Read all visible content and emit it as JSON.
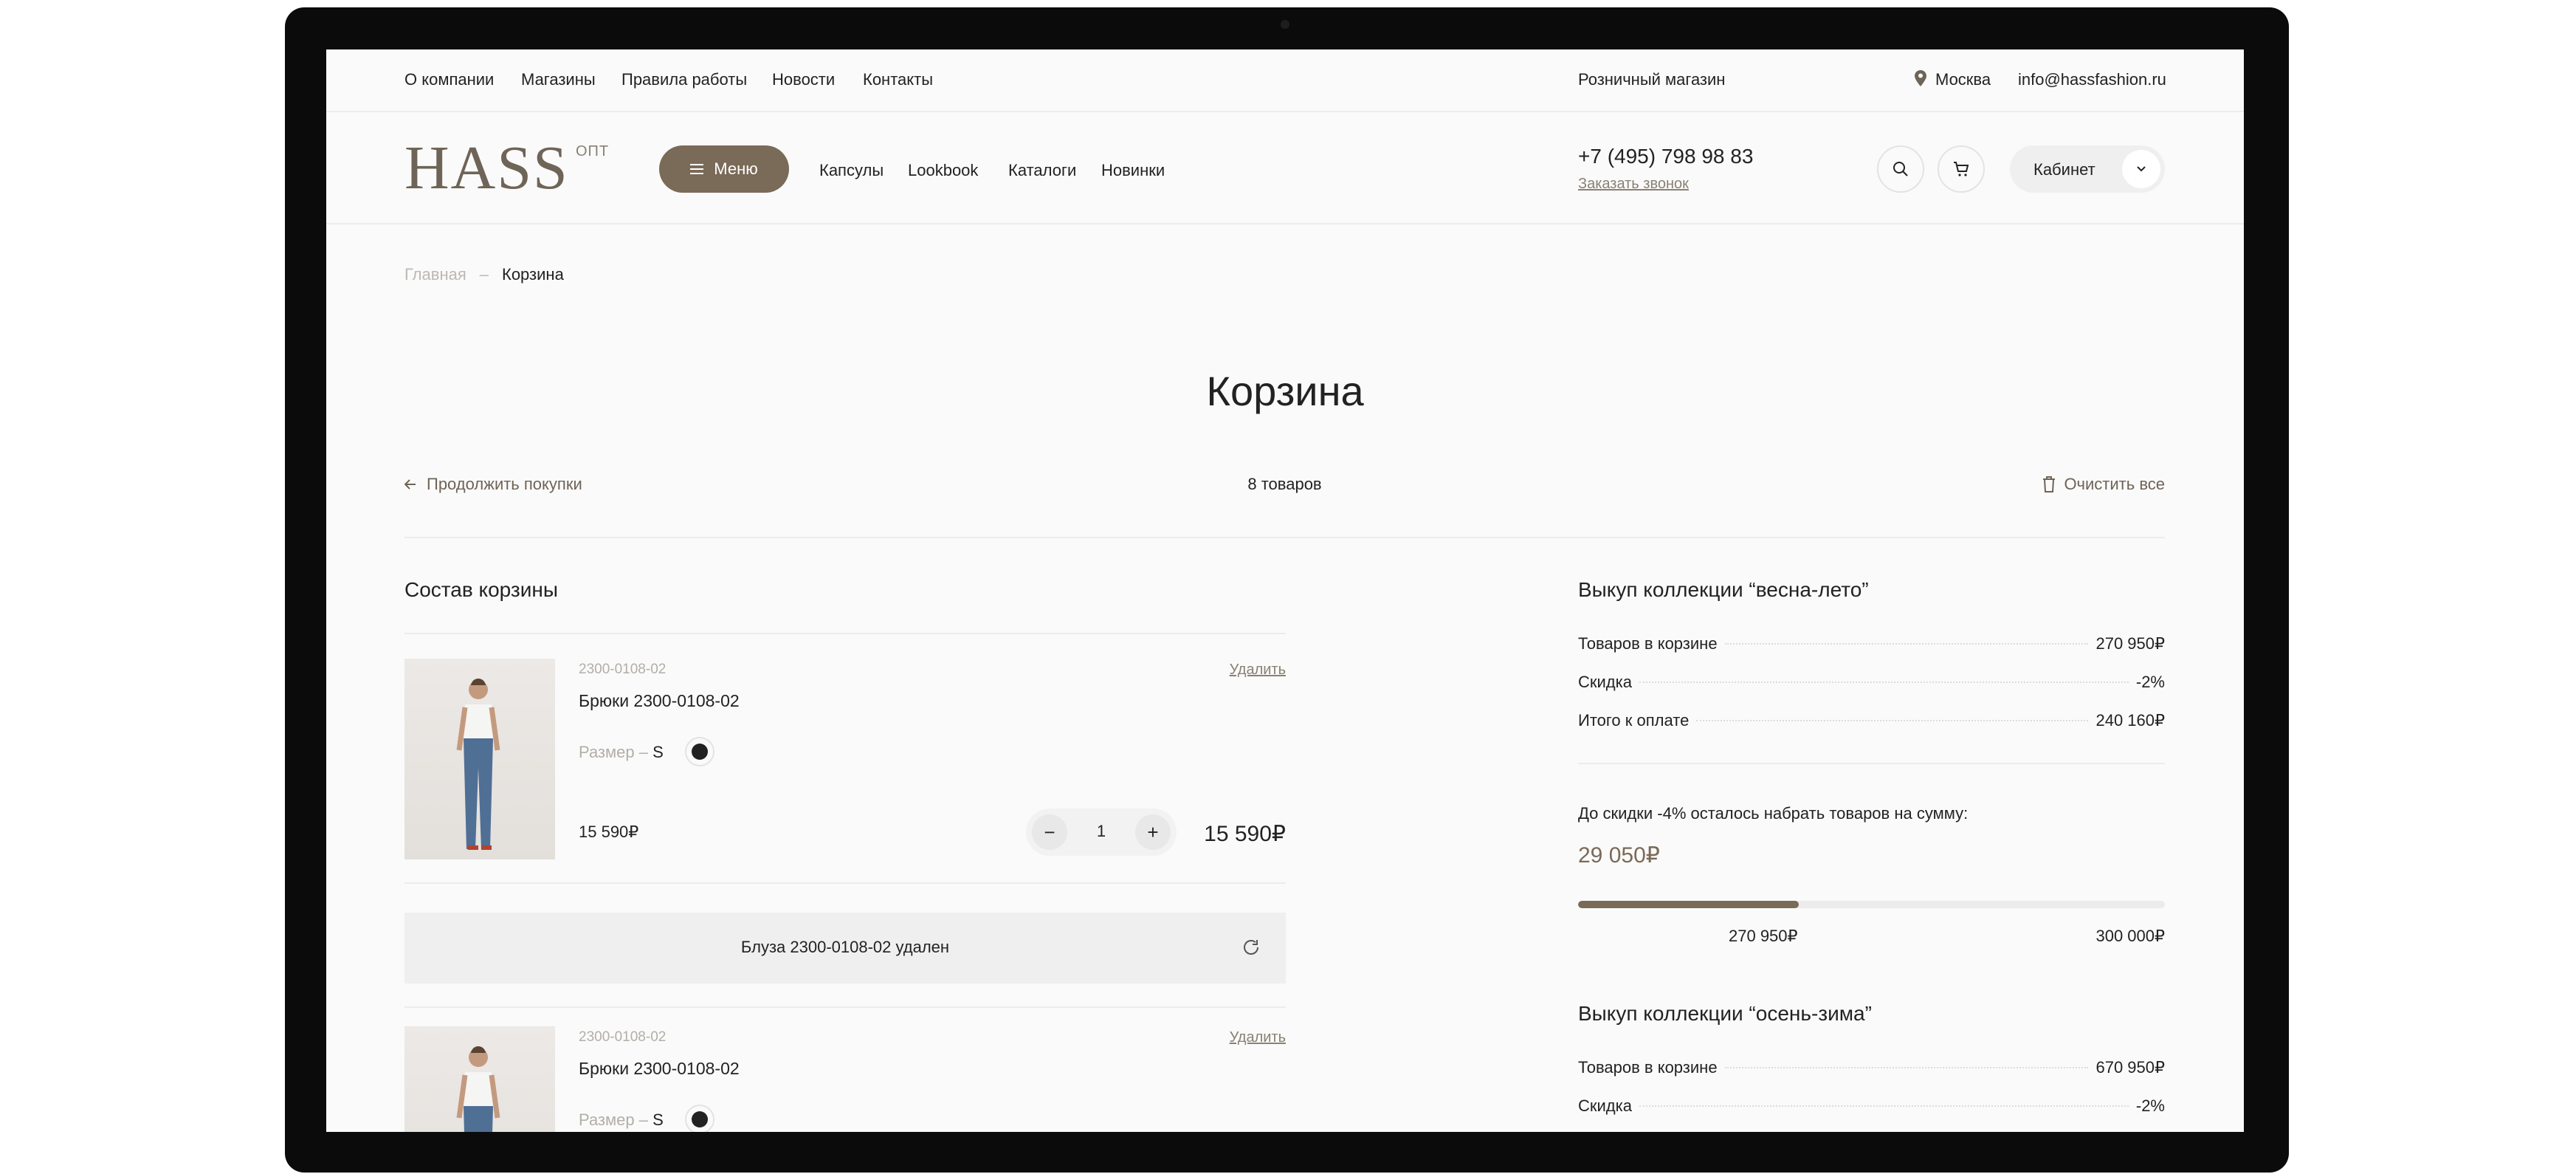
{
  "topbar": {
    "links": [
      "О компании",
      "Магазины",
      "Правила работы",
      "Новости",
      "Контакты"
    ],
    "retail": "Розничный магазин",
    "city": "Москва",
    "email": "info@hassfashion.ru"
  },
  "header": {
    "logo": "HASS",
    "logo_sub": "ОПТ",
    "menu_label": "Меню",
    "nav": [
      "Капсулы",
      "Lookbook",
      "Каталоги",
      "Новинки"
    ],
    "phone": "+7 (495) 798 98 83",
    "callback": "Заказать звонок",
    "cabinet": "Кабинет"
  },
  "breadcrumb": {
    "home": "Главная",
    "sep": "–",
    "current": "Корзина"
  },
  "page_title": "Корзина",
  "toolbar": {
    "continue": "Продолжить покупки",
    "count": "8 товаров",
    "clear": "Очистить все"
  },
  "cart": {
    "title": "Состав корзины",
    "items": [
      {
        "article": "2300-0108-02",
        "name": "Брюки 2300-0108-02",
        "size_label": "Размер –",
        "size": "S",
        "price": "15 590₽",
        "qty": "1",
        "total": "15 590₽",
        "delete": "Удалить",
        "swatch_color": "#222222"
      },
      {
        "article": "2300-0108-02",
        "name": "Брюки 2300-0108-02",
        "size_label": "Размер –",
        "size": "S",
        "delete": "Удалить",
        "swatch_color": "#222222"
      }
    ],
    "removed_notice": "Блуза 2300-0108-02 удален"
  },
  "summary": {
    "spring": {
      "title": "Выкуп коллекции “весна-лето”",
      "rows": [
        {
          "label": "Товаров в корзине",
          "value": "270 950₽"
        },
        {
          "label": "Скидка",
          "value": "-2%"
        },
        {
          "label": "Итого к оплате",
          "value": "240 160₽"
        }
      ],
      "note": "До скидки -4% осталось набрать товаров на сумму:",
      "remain": "29 050₽",
      "progress_fraction": 0.376,
      "progress_current": "270 950₽",
      "progress_target": "300 000₽"
    },
    "autumn": {
      "title": "Выкуп коллекции “осень-зима”",
      "rows": [
        {
          "label": "Товаров в корзине",
          "value": "670 950₽"
        },
        {
          "label": "Скидка",
          "value": "-2%"
        }
      ]
    }
  },
  "colors": {
    "accent": "#7a6a58",
    "muted": "#8a8074"
  }
}
